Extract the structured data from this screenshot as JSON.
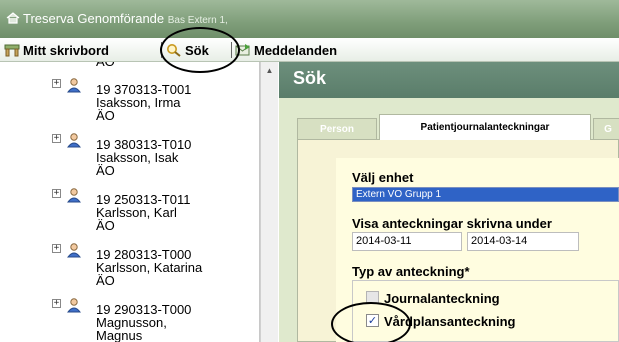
{
  "window": {
    "title": "Treserva Genomförande",
    "subtitle": "Bas Extern 1,"
  },
  "menubar": {
    "items": [
      {
        "label": "Mitt skrivbord",
        "icon": "desk-icon"
      },
      {
        "label": "Sök",
        "icon": "search-icon"
      },
      {
        "label": "Meddelanden",
        "icon": "messages-icon"
      }
    ]
  },
  "tree": {
    "top_fragment": "ÄO",
    "items": [
      {
        "id": "19 370313-T001",
        "name": "Isaksson, Irma",
        "unit": "ÄO"
      },
      {
        "id": "19 380313-T010",
        "name": "Isaksson, Isak",
        "unit": "ÄO"
      },
      {
        "id": "19 250313-T011",
        "name": "Karlsson, Karl",
        "unit": "ÄO"
      },
      {
        "id": "19 280313-T000",
        "name": "Karlsson, Katarina",
        "unit": "ÄO"
      },
      {
        "id": "19 290313-T000",
        "name": "Magnusson,",
        "unit": "Magnus"
      }
    ]
  },
  "page": {
    "title": "Sök",
    "tabs": [
      {
        "label": "Person",
        "active": false
      },
      {
        "label": "Patientjournalanteckningar",
        "active": true
      },
      {
        "label": "G",
        "active": false
      }
    ],
    "unit_label": "Välj enhet",
    "unit_value": "Extern VO Grupp 1",
    "period_label": "Visa anteckningar skrivna under",
    "date_from": "2014-03-11",
    "date_to": "2014-03-14",
    "type_label": "Typ av anteckning*",
    "options": [
      {
        "label": "Journalanteckning",
        "checked": false,
        "disabled": true
      },
      {
        "label": "Vårdplansanteckning",
        "checked": true,
        "disabled": false
      }
    ]
  },
  "colors": {
    "titlebar": "#7f9e7a",
    "header": "#5a7d6a",
    "select": "#2f63c6"
  }
}
